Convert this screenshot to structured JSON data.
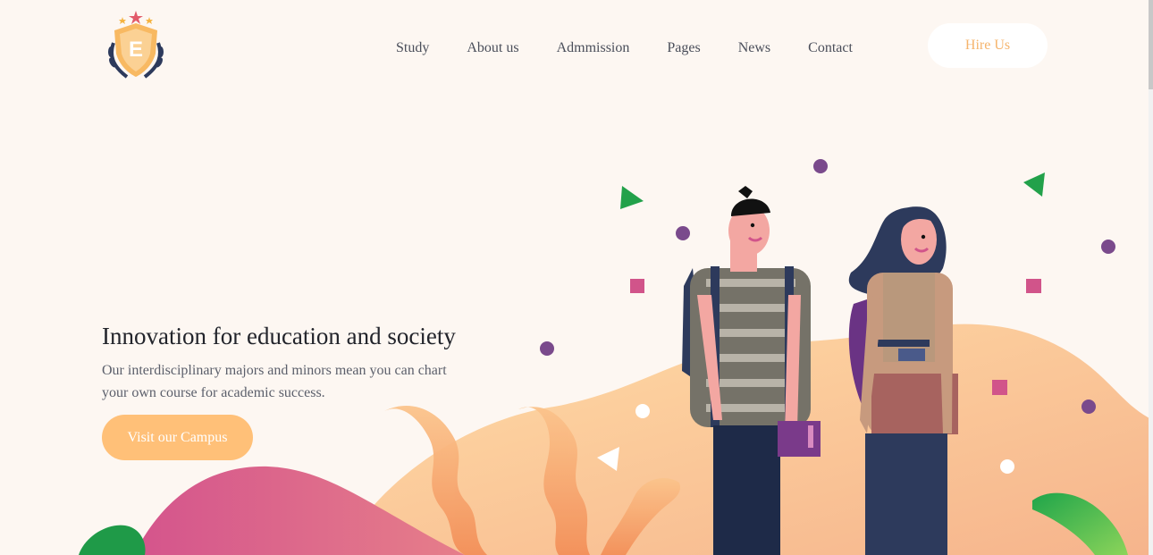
{
  "header": {
    "logo": {
      "letter": "E",
      "icon": "shield-laurel-logo"
    },
    "nav": [
      "Study",
      "About us",
      "Admmission",
      "Pages",
      "News",
      "Contact"
    ],
    "hire_label": "Hire Us"
  },
  "hero": {
    "title": "Innovation for education and society",
    "subtitle_line1": "Our interdisciplinary majors and minors mean you can chart",
    "subtitle_line2": "your own course for academic success.",
    "cta_label": "Visit our Campus"
  },
  "colors": {
    "background": "#fdf7f2",
    "accent": "#ffc078",
    "nav_text": "#4a4e5a",
    "hire_text": "#f5b46c"
  }
}
